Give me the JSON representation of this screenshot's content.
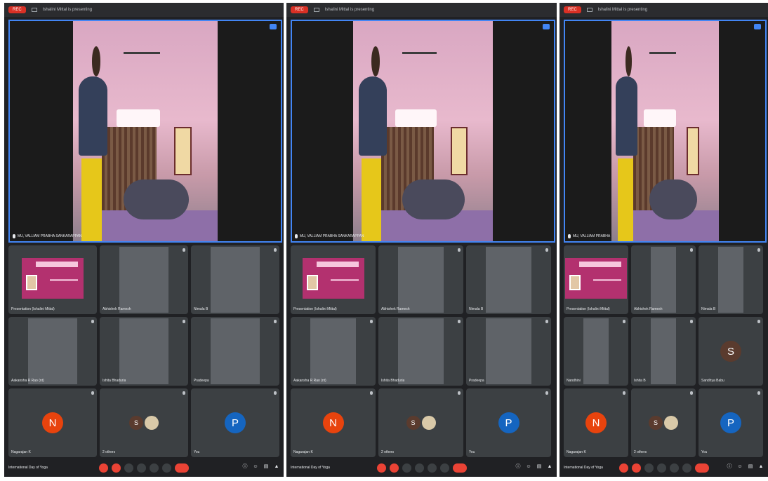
{
  "screens": [
    {
      "rec_label": "REC",
      "presenting_text": "Ishalini Mittal is presenting",
      "main_speaker_name": "MU, VALLIAM PRABHA SANKARAPPAN",
      "presentation_tile_name": "Presentation (Ishalini Mittal)",
      "tiles": [
        {
          "name": "Abhishek Ramesh",
          "kind": "video"
        },
        {
          "name": "Nimala B",
          "kind": "video"
        },
        {
          "name": "Aakansha R Rao (nt)",
          "kind": "video"
        },
        {
          "name": "Ishita Bhaduria",
          "kind": "video"
        },
        {
          "name": "Pradeepa",
          "kind": "video"
        },
        {
          "name": "Nagarajan K",
          "kind": "avatar",
          "initial": "N"
        },
        {
          "name": "2 others",
          "kind": "pair",
          "initial": "S"
        },
        {
          "name": "You",
          "kind": "avatar",
          "initial": "P"
        }
      ],
      "meeting_title": "International Day of Yoga"
    },
    {
      "rec_label": "REC",
      "presenting_text": "Ishalini Mittal is presenting",
      "main_speaker_name": "MU, VALLIAM PRABHA SANKARAPPAN",
      "presentation_tile_name": "Presentation (Ishalini Mittal)",
      "tiles": [
        {
          "name": "Abhishek Ramesh",
          "kind": "video"
        },
        {
          "name": "Nimala B",
          "kind": "video"
        },
        {
          "name": "Aakansha R Rao (nt)",
          "kind": "video"
        },
        {
          "name": "Ishita Bhaduria",
          "kind": "video"
        },
        {
          "name": "Pradeepa",
          "kind": "video"
        },
        {
          "name": "Nagarajan K",
          "kind": "avatar",
          "initial": "N"
        },
        {
          "name": "2 others",
          "kind": "pair",
          "initial": "S"
        },
        {
          "name": "You",
          "kind": "avatar",
          "initial": "P"
        }
      ],
      "meeting_title": "International Day of Yoga"
    },
    {
      "rec_label": "REC",
      "presenting_text": "Ishalini Mittal is presenting",
      "main_speaker_name": "MU, VALLIAM PRABHA",
      "presentation_tile_name": "Presentation (Ishalini Mittal)",
      "tiles": [
        {
          "name": "Abhishek Ramesh",
          "kind": "video"
        },
        {
          "name": "Nimala B",
          "kind": "video"
        },
        {
          "name": "Nandhini",
          "kind": "video"
        },
        {
          "name": "Ishita B",
          "kind": "video"
        },
        {
          "name": "Sandhya Babu",
          "kind": "avatar",
          "initial": "S"
        },
        {
          "name": "Nagarajan K",
          "kind": "avatar",
          "initial": "N"
        },
        {
          "name": "2 others",
          "kind": "pair",
          "initial": "S"
        },
        {
          "name": "You",
          "kind": "avatar",
          "initial": "P"
        }
      ],
      "meeting_title": "International Day of Yoga"
    }
  ],
  "presentation_slide": {
    "heading": "Shri Rajiv Mittal",
    "subtitle": "International Day of Yoga"
  },
  "colors": {
    "rec": "#d93025",
    "speaker_border": "#4285f4",
    "avatar_n": "#e8430d",
    "avatar_p": "#1565c0",
    "avatar_s": "#5a3b2e",
    "end_call": "#ea4335"
  }
}
